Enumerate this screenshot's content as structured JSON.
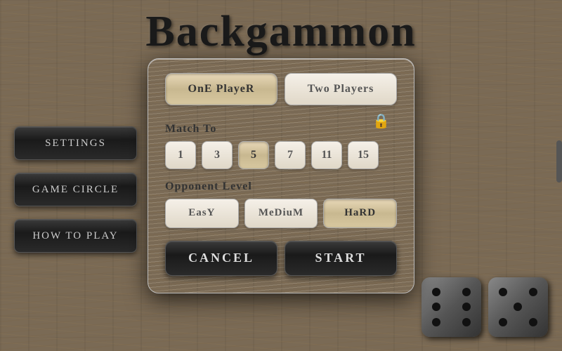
{
  "title": "Backgammon",
  "sidebar": {
    "buttons": [
      {
        "id": "settings",
        "label": "Settings"
      },
      {
        "id": "game-circle",
        "label": "Game Circle"
      },
      {
        "id": "how-to-play",
        "label": "How To Play"
      }
    ]
  },
  "dialog": {
    "mode_buttons": [
      {
        "id": "one-player",
        "label": "OnE PlayeR",
        "active": true
      },
      {
        "id": "two-players",
        "label": "Two Players",
        "active": false
      }
    ],
    "match_to_label": "Match To",
    "match_options": [
      {
        "value": "1",
        "active": false
      },
      {
        "value": "3",
        "active": false
      },
      {
        "value": "5",
        "active": true
      },
      {
        "value": "7",
        "active": false
      },
      {
        "value": "11",
        "active": false
      },
      {
        "value": "15",
        "active": false
      }
    ],
    "opponent_label": "Opponent Level",
    "level_options": [
      {
        "id": "easy",
        "label": "EasY",
        "active": false
      },
      {
        "id": "medium",
        "label": "MeDiuM",
        "active": false
      },
      {
        "id": "hard",
        "label": "HaRD",
        "active": true
      }
    ],
    "cancel_label": "Cancel",
    "start_label": "Start"
  }
}
